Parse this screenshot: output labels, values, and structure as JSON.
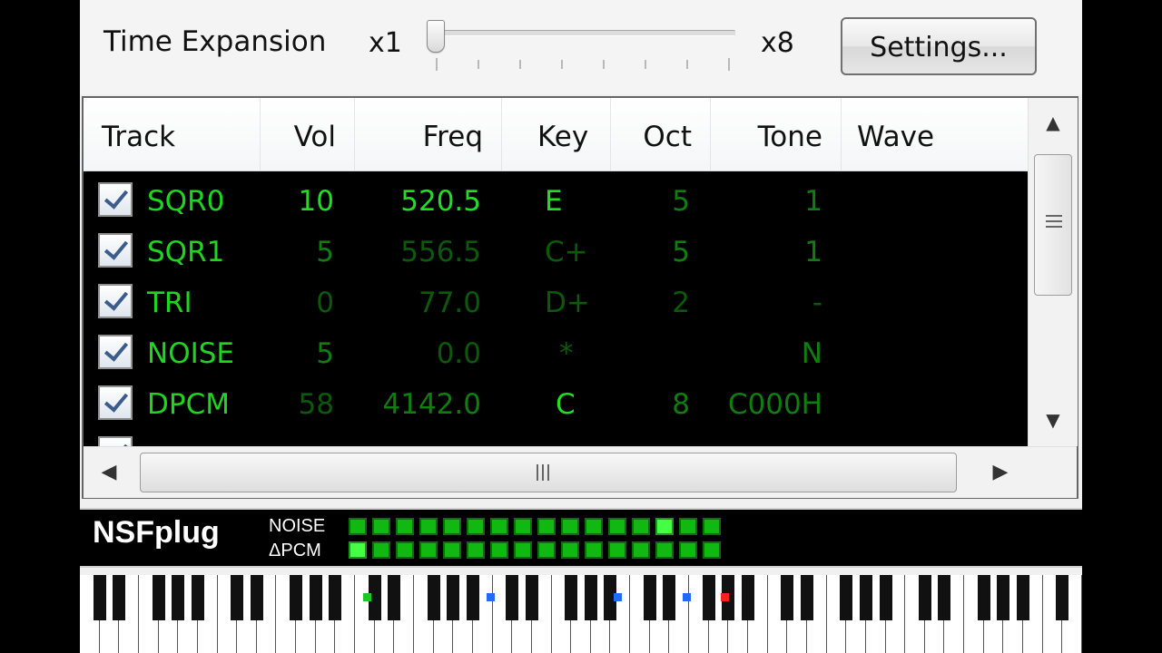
{
  "top": {
    "time_expansion_label": "Time Expansion",
    "slider_min": "x1",
    "slider_max": "x8",
    "slider_position": 0,
    "settings_label": "Settings..."
  },
  "table": {
    "headers": [
      "Track",
      "Vol",
      "Freq",
      "Key",
      "Oct",
      "Tone",
      "Wave"
    ],
    "rows": [
      {
        "checked": true,
        "track": "SQR0",
        "vol": "10",
        "freq": "520.5",
        "key": "E",
        "oct": "5",
        "tone": "1"
      },
      {
        "checked": true,
        "track": "SQR1",
        "vol": "5",
        "freq": "556.5",
        "key": "C+",
        "oct": "5",
        "tone": "1"
      },
      {
        "checked": true,
        "track": "TRI",
        "vol": "0",
        "freq": "77.0",
        "key": "D+",
        "oct": "2",
        "tone": "-"
      },
      {
        "checked": true,
        "track": "NOISE",
        "vol": "5",
        "freq": "0.0",
        "key": "*",
        "oct": "",
        "tone": "N"
      },
      {
        "checked": true,
        "track": "DPCM",
        "vol": "58",
        "freq": "4142.0",
        "key": "C",
        "oct": "8",
        "tone": "C000H"
      }
    ]
  },
  "nsf": {
    "logo": "NSFplug",
    "meters": [
      {
        "label": "NOISE",
        "leds": 16,
        "lit_index": 13
      },
      {
        "label": "ΔPCM",
        "leds": 16,
        "lit_index": 0
      }
    ]
  },
  "keyboard": {
    "active_keys": [
      {
        "color": "#1ec81e"
      },
      {
        "color": "#1e6cff"
      },
      {
        "color": "#1e6cff"
      },
      {
        "color": "#1e6cff"
      },
      {
        "color": "#ff2020"
      }
    ]
  }
}
